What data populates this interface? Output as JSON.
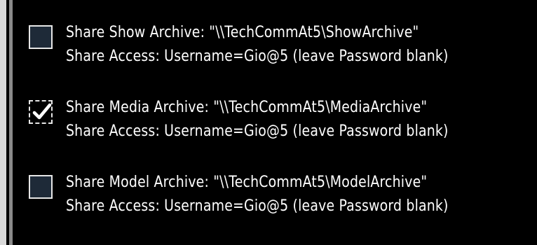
{
  "options": [
    {
      "checked": false,
      "line1": "Share Show Archive: \"\\\\TechCommAt5\\ShowArchive\"",
      "line2": "Share Access: Username=Gio@5 (leave Password blank)"
    },
    {
      "checked": true,
      "line1": "Share Media Archive: \"\\\\TechCommAt5\\MediaArchive\"",
      "line2": "Share Access: Username=Gio@5 (leave Password blank)"
    },
    {
      "checked": false,
      "line1": "Share Model Archive: \"\\\\TechCommAt5\\ModelArchive\"",
      "line2": "Share Access: Username=Gio@5 (leave Password blank)"
    }
  ],
  "icons": {
    "checked_glyph": "checkmark-icon"
  },
  "colors": {
    "background": "#000000",
    "text": "#ffffff",
    "checkbox_fill": "#1e2a38",
    "border": "#d9d9d9"
  }
}
